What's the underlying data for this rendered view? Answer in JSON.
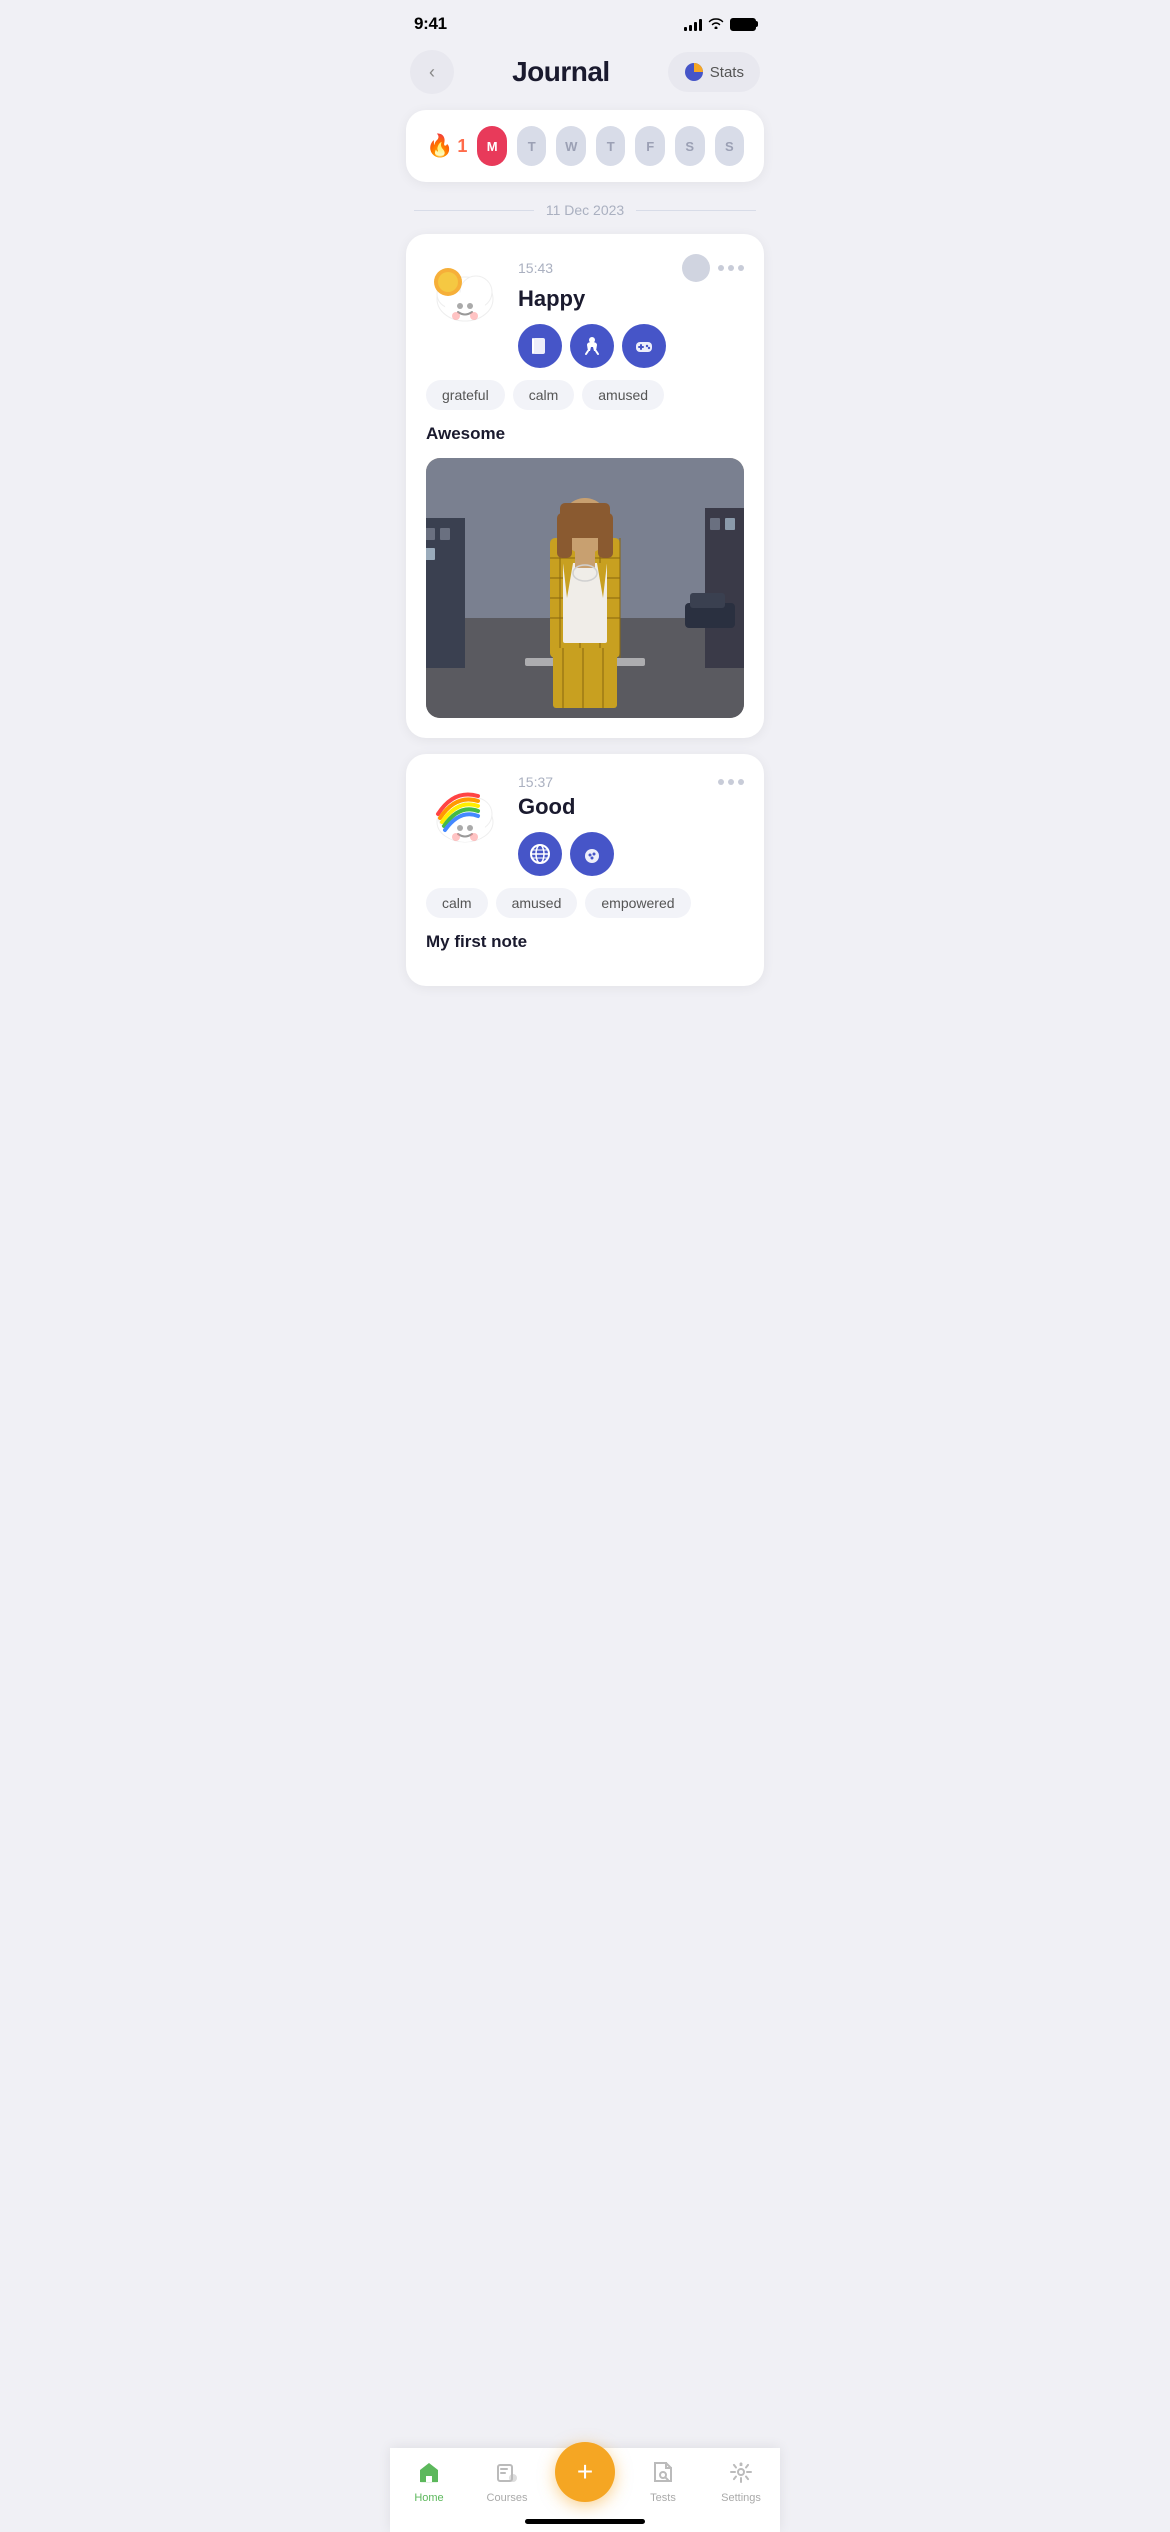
{
  "status": {
    "time": "9:41",
    "signal_bars": [
      4,
      6,
      8,
      10,
      12
    ],
    "wifi": "wifi",
    "battery": "full"
  },
  "header": {
    "back_label": "‹",
    "title": "Journal",
    "stats_label": "Stats"
  },
  "streak": {
    "count": "1",
    "days": [
      {
        "label": "M",
        "active": true
      },
      {
        "label": "T",
        "active": false
      },
      {
        "label": "W",
        "active": false
      },
      {
        "label": "T",
        "active": false
      },
      {
        "label": "F",
        "active": false
      },
      {
        "label": "S",
        "active": false
      },
      {
        "label": "S",
        "active": false
      }
    ]
  },
  "date_separator": "11 Dec 2023",
  "entries": [
    {
      "time": "15:43",
      "mood": "Happy",
      "activities": [
        "📚",
        "🏋️",
        "🎮"
      ],
      "tags": [
        "grateful",
        "calm",
        "amused"
      ],
      "note": "Awesome",
      "has_image": true
    },
    {
      "time": "15:37",
      "mood": "Good",
      "activities": [
        "🌐",
        "🍪"
      ],
      "tags": [
        "calm",
        "amused",
        "empowered"
      ],
      "note": "My first note",
      "has_image": false
    }
  ],
  "bottom_nav": {
    "items": [
      {
        "label": "Home",
        "icon": "home",
        "active": true
      },
      {
        "label": "Courses",
        "icon": "courses",
        "active": false
      },
      {
        "label": "add",
        "icon": "plus",
        "active": false,
        "is_add": true
      },
      {
        "label": "Tests",
        "icon": "tests",
        "active": false
      },
      {
        "label": "Settings",
        "icon": "settings",
        "active": false
      }
    ]
  },
  "icons": {
    "back": "‹",
    "plus": "+",
    "stats_pie": "◑"
  }
}
